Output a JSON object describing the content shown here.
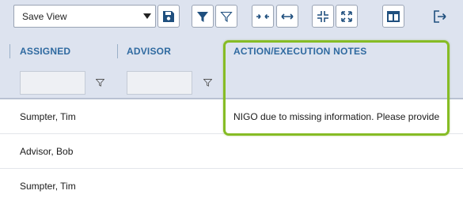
{
  "toolbar": {
    "view_select_value": "Save View",
    "buttons": [
      {
        "icon": "save-icon"
      },
      {
        "icon": "filter-filled-icon"
      },
      {
        "icon": "filter-outline-icon"
      },
      {
        "icon": "collapse-columns-icon"
      },
      {
        "icon": "expand-columns-icon"
      },
      {
        "icon": "compress-icon"
      },
      {
        "icon": "expand-icon"
      },
      {
        "icon": "column-layout-icon"
      },
      {
        "icon": "export-icon"
      }
    ]
  },
  "table": {
    "columns": [
      {
        "label": "ASSIGNED"
      },
      {
        "label": "ADVISOR"
      },
      {
        "label": "ACTION/EXECUTION NOTES"
      }
    ],
    "rows": [
      {
        "assigned": "Sumpter, Tim",
        "advisor": "",
        "notes": "NIGO due to missing information. Please provide"
      },
      {
        "assigned": "Advisor, Bob",
        "advisor": "",
        "notes": ""
      },
      {
        "assigned": "Sumpter, Tim",
        "advisor": "",
        "notes": ""
      }
    ]
  },
  "colors": {
    "header_bg": "#dde3ef",
    "header_text": "#2f6aa0",
    "icon_blue": "#1f4f7e",
    "highlight": "#86bc25"
  }
}
